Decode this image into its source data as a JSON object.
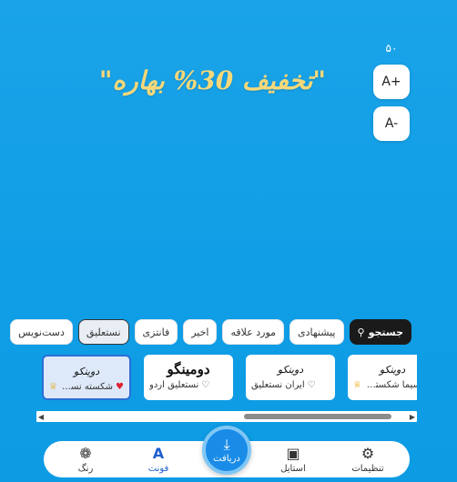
{
  "canvas": {
    "text": "\"تخفیف 30% بهاره\""
  },
  "size_controls": {
    "value": "۵۰",
    "increase_label": "A+",
    "decrease_label": "A-"
  },
  "categories": {
    "search_label": "جستجو",
    "items": [
      "پیشنهادی",
      "مورد علاقه",
      "اخیر",
      "فانتزی",
      "نستعلیق",
      "دست‌نویس"
    ],
    "active": "نستعلیق"
  },
  "fonts": [
    {
      "preview": "دوینکو",
      "name": "شکسته نستع...",
      "favorite": true,
      "premium": true,
      "selected": true
    },
    {
      "preview": "دومینگو",
      "name": "نستعلیق اردو",
      "favorite": false,
      "premium": false,
      "selected": false
    },
    {
      "preview": "دوینکو",
      "name": "ایران نستعلیق",
      "favorite": false,
      "premium": false,
      "selected": false
    },
    {
      "preview": "دوینکو",
      "name": "سیما شکسته ...",
      "favorite": false,
      "premium": true,
      "selected": false
    }
  ],
  "nav": {
    "settings": "تنظیمات",
    "style": "استایل",
    "download": "دریافت",
    "font": "فونت",
    "color": "رنگ"
  },
  "colors": {
    "accent": "#1f5fd0",
    "background": "#109ee6",
    "canvas_text": "#f5d87a"
  }
}
